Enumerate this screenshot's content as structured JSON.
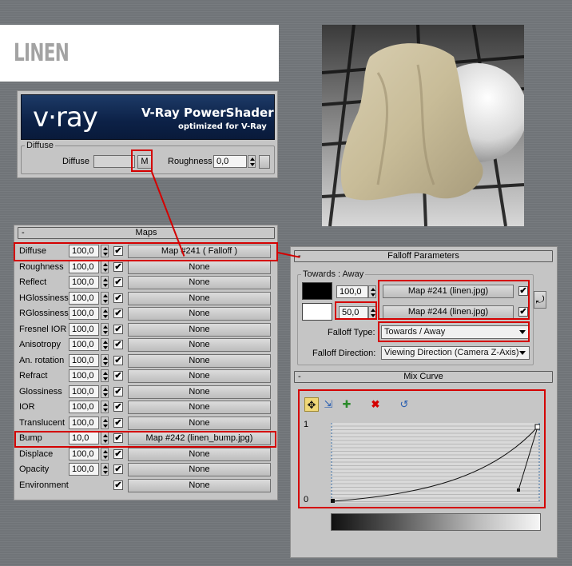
{
  "title": "LINEN",
  "vray": {
    "logo_text": "v·ray",
    "product_title": "V-Ray PowerShader",
    "product_subtitle": "optimized for V-Ray",
    "group_label": "Diffuse",
    "diffuse_label": "Diffuse",
    "map_button": "M",
    "roughness_label": "Roughness",
    "roughness_value": "0,0"
  },
  "maps": {
    "header": "Maps",
    "collapse": "-",
    "check_glyph": "✔",
    "rows": [
      {
        "label": "Diffuse",
        "amount": "100,0",
        "checked": true,
        "map": "Map #241  ( Falloff )"
      },
      {
        "label": "Roughness",
        "amount": "100,0",
        "checked": true,
        "map": "None"
      },
      {
        "label": "Reflect",
        "amount": "100,0",
        "checked": true,
        "map": "None"
      },
      {
        "label": "HGlossiness",
        "amount": "100,0",
        "checked": true,
        "map": "None"
      },
      {
        "label": "RGlossiness",
        "amount": "100,0",
        "checked": true,
        "map": "None"
      },
      {
        "label": "Fresnel IOR",
        "amount": "100,0",
        "checked": true,
        "map": "None"
      },
      {
        "label": "Anisotropy",
        "amount": "100,0",
        "checked": true,
        "map": "None"
      },
      {
        "label": "An. rotation",
        "amount": "100,0",
        "checked": true,
        "map": "None"
      },
      {
        "label": "Refract",
        "amount": "100,0",
        "checked": true,
        "map": "None"
      },
      {
        "label": "Glossiness",
        "amount": "100,0",
        "checked": true,
        "map": "None"
      },
      {
        "label": "IOR",
        "amount": "100,0",
        "checked": true,
        "map": "None"
      },
      {
        "label": "Translucent",
        "amount": "100,0",
        "checked": true,
        "map": "None"
      },
      {
        "label": "Bump",
        "amount": "10,0",
        "checked": true,
        "map": "Map #242 (linen_bump.jpg)"
      },
      {
        "label": "Displace",
        "amount": "100,0",
        "checked": true,
        "map": "None"
      },
      {
        "label": "Opacity",
        "amount": "100,0",
        "checked": true,
        "map": "None"
      },
      {
        "label": "Environment",
        "amount": "",
        "checked": true,
        "map": "None"
      }
    ]
  },
  "falloff": {
    "header": "Falloff Parameters",
    "collapse": "-",
    "group_label": "Towards : Away",
    "slot1": {
      "color": "#000000",
      "amount": "100,0",
      "map": "Map #241 (linen.jpg)",
      "checked": true
    },
    "slot2": {
      "color": "#ffffff",
      "amount": "50,0",
      "map": "Map #244 (linen.jpg)",
      "checked": true
    },
    "swap_glyph": "⤾",
    "type_label": "Falloff Type:",
    "type_value": "Towards / Away",
    "direction_label": "Falloff Direction:",
    "direction_value": "Viewing Direction (Camera Z-Axis)"
  },
  "mix_curve": {
    "header": "Mix Curve",
    "collapse": "-",
    "y_max_label": "1",
    "y_min_label": "0",
    "tools": [
      "move-icon",
      "scale-icon",
      "add-point-icon",
      "delete-point-icon",
      "reset-curve-icon"
    ]
  },
  "colors": {
    "highlight": "#d40000",
    "background": "#707478",
    "panel": "#c5c5c5"
  }
}
